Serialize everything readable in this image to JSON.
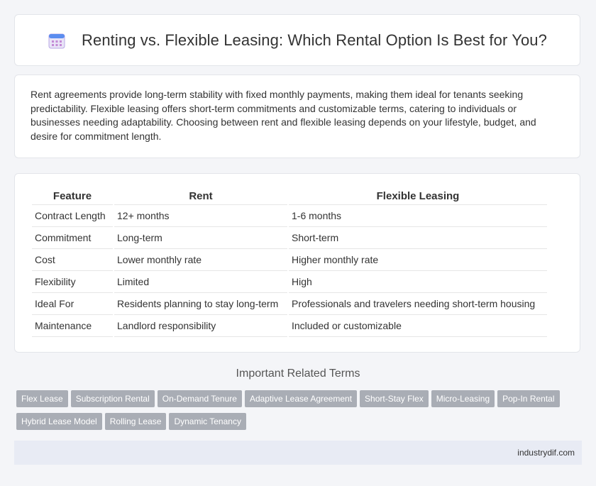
{
  "header": {
    "title": "Renting vs. Flexible Leasing: Which Rental Option Is Best for You?",
    "icon": "calendar-icon"
  },
  "intro": {
    "text": "Rent agreements provide long-term stability with fixed monthly payments, making them ideal for tenants seeking predictability. Flexible leasing offers short-term commitments and customizable terms, catering to individuals or businesses needing adaptability. Choosing between rent and flexible leasing depends on your lifestyle, budget, and desire for commitment length."
  },
  "table": {
    "headers": [
      "Feature",
      "Rent",
      "Flexible Leasing"
    ],
    "rows": [
      [
        "Contract Length",
        "12+ months",
        "1-6 months"
      ],
      [
        "Commitment",
        "Long-term",
        "Short-term"
      ],
      [
        "Cost",
        "Lower monthly rate",
        "Higher monthly rate"
      ],
      [
        "Flexibility",
        "Limited",
        "High"
      ],
      [
        "Ideal For",
        "Residents planning to stay long-term",
        "Professionals and travelers needing short-term housing"
      ],
      [
        "Maintenance",
        "Landlord responsibility",
        "Included or customizable"
      ]
    ]
  },
  "related": {
    "title": "Important Related Terms",
    "tags": [
      "Flex Lease",
      "Subscription Rental",
      "On-Demand Tenure",
      "Adaptive Lease Agreement",
      "Short-Stay Flex",
      "Micro-Leasing",
      "Pop-In Rental",
      "Hybrid Lease Model",
      "Rolling Lease",
      "Dynamic Tenancy"
    ]
  },
  "footer": {
    "site": "industrydif.com"
  }
}
